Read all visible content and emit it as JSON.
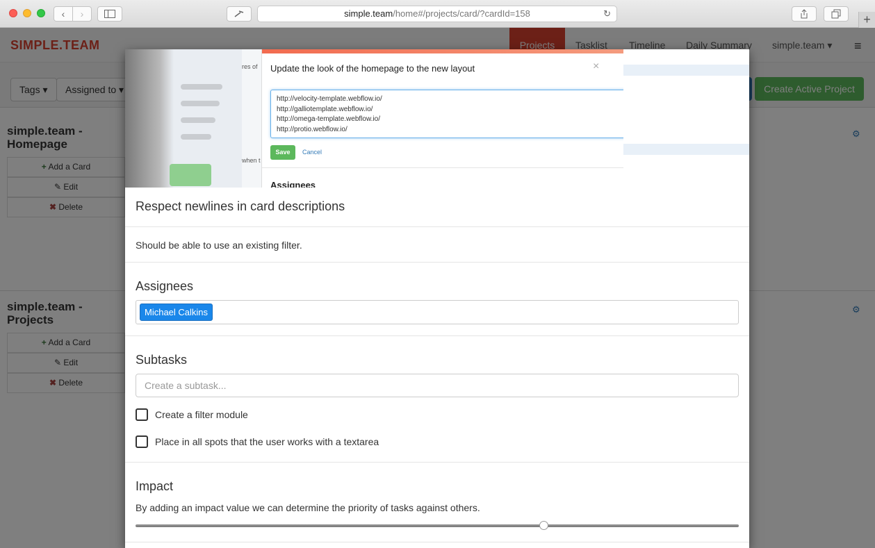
{
  "browser": {
    "url_host": "simple.team",
    "url_path": "/home#/projects/card/?cardId=158",
    "back_icon": "‹",
    "forward_icon": "›",
    "new_tab_icon": "+"
  },
  "app": {
    "brand": "SIMPLE.TEAM",
    "nav": [
      "Projects",
      "Tasklist",
      "Timeline",
      "Daily Summary",
      "simple.team ▾"
    ],
    "filters": [
      "Tags ▾",
      "Assigned to ▾"
    ],
    "create_button": "Create Active Project",
    "projects": [
      {
        "title": "simple.team - Homepage",
        "add": "Add a Card",
        "edit": "Edit",
        "delete": "Delete"
      },
      {
        "title": "simple.team - Projects",
        "add": "Add a Card",
        "edit": "Edit",
        "delete": "Delete"
      }
    ]
  },
  "card": {
    "screenshot": {
      "title": "Update the look of the homepage to the new layout",
      "links": [
        "http://velocity-template.webflow.io/",
        "http://galliotemplate.webflow.io/",
        "http://omega-template.webflow.io/",
        "http://protio.webflow.io/"
      ],
      "save": "Save",
      "cancel": "Cancel",
      "assignees_heading": "Assignees",
      "close": "×",
      "partial_text_1": "res of",
      "partial_text_2": "when t"
    },
    "title": "Respect newlines in card descriptions",
    "description": "Should be able to use an existing filter.",
    "assignees_heading": "Assignees",
    "assignees": [
      "Michael Calkins"
    ],
    "subtasks_heading": "Subtasks",
    "subtask_placeholder": "Create a subtask...",
    "subtasks": [
      {
        "label": "Create a filter module",
        "checked": false
      },
      {
        "label": "Place in all spots that the user works with a textarea",
        "checked": false
      }
    ],
    "impact_heading": "Impact",
    "impact_text": "By adding an impact value we can determine the priority of tasks against others.",
    "impact_value": 0.67
  }
}
